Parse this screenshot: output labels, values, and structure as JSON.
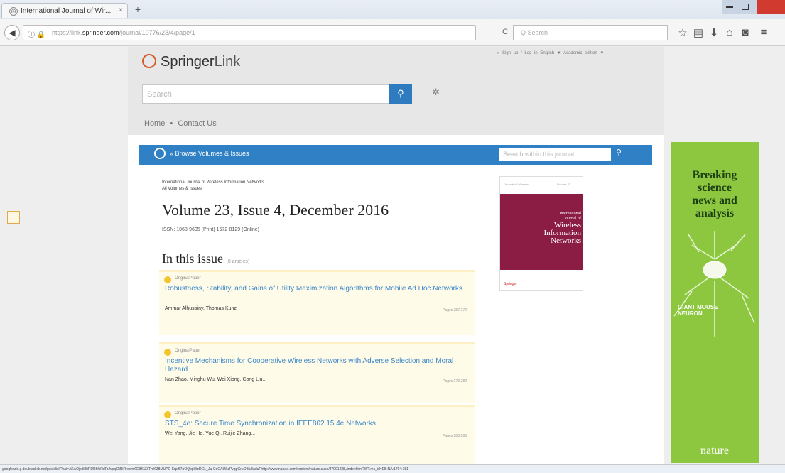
{
  "browser": {
    "tab_title": "International Journal of Wir...",
    "tab_close": "×",
    "new_tab": "+",
    "back": "◀",
    "url_prefix": "https://link.",
    "url_domain": "springer.com",
    "url_path": "/journal/10776/23/4/page/1",
    "reload": "C",
    "search_placeholder": "Q Search",
    "toolbar_icons": [
      "star-icon",
      "library-icon",
      "download-icon",
      "home-icon",
      "pocket-icon",
      "menu-icon"
    ],
    "status_url": "googleads.g.doubleclick.net/pcs/click?xai=AKAOjsttl8fiRDRhfsRdFrJvpqlDiRlRrvomKCBKtZ3TmKZ8MUPC-Erpf57uOQopWzDGL_Ju-CqGAUSzPvqpGruOBaBaduFhttp://www.nature.com/content/nature.subs/87001428,/indexhtml?WT.mc_id=EB:NA:1704:181"
  },
  "header": {
    "logo_brand": "Springer",
    "logo_link": "Link",
    "top_links": "» Sign up / Log in   English ▼   Academic edition ▼",
    "search_placeholder": "Search",
    "search_icon": "search-icon",
    "settings_icon": "gear-icon",
    "breadcrumb_home": "Home",
    "breadcrumb_sep": "•",
    "breadcrumb_contact": "Contact Us"
  },
  "journal_bar": {
    "browse_label": "» Browse Volumes & Issues",
    "search_placeholder": "Search within this journal",
    "search_icon": "search-icon"
  },
  "issue": {
    "journal_name": "International Journal of Wireless Information Networks",
    "all_volumes": "All Volumes & Issues",
    "title": "Volume 23, Issue 4, December 2016",
    "issn": "ISSN: 1068-9605 (Print) 1572-8129 (Online)",
    "in_this_issue": "In this issue",
    "article_count": "(8 articles)"
  },
  "cover": {
    "header_left": "Journal of Wireless",
    "header_right": "Volume 23",
    "line1": "International",
    "line2": "Journal of",
    "line3": "Wireless",
    "line4": "Information",
    "line5": "Networks",
    "publisher": "Springer",
    "color": "#8b1d44"
  },
  "articles": [
    {
      "type": "OriginalPaper",
      "title": "Robustness, Stability, and Gains of Utility Maximization Algorithms for Mobile Ad Hoc Networks",
      "authors": "Ammar Alhusainy, Thomas Kunz",
      "pages": "Pages 257-272"
    },
    {
      "type": "OriginalPaper",
      "title": "Incentive Mechanisms for Cooperative Wireless Networks with Adverse Selection and Moral Hazard",
      "authors": "Nan Zhao, Minghu Wu, Wei Xiong, Cong Liu...",
      "pages": "Pages 273-282"
    },
    {
      "type": "OriginalPaper",
      "title": "STS_4e: Secure Time Synchronization in IEEE802.15.4e Networks",
      "authors": "Wei Yang, Jie He, Yue Qi, Ruijie Zhang...",
      "pages": "Pages 283-296"
    }
  ],
  "ad": {
    "headline1": "Breaking",
    "headline2": "science",
    "headline3": "news and",
    "headline4": "analysis",
    "mouse1": "GIANT MOUSE",
    "mouse2": "NEURON",
    "brand": "nature",
    "bg_color": "#8dc73f"
  },
  "colors": {
    "accent": "#2f80c4",
    "link": "#3a87c8",
    "article_bg": "#fffbe9"
  }
}
